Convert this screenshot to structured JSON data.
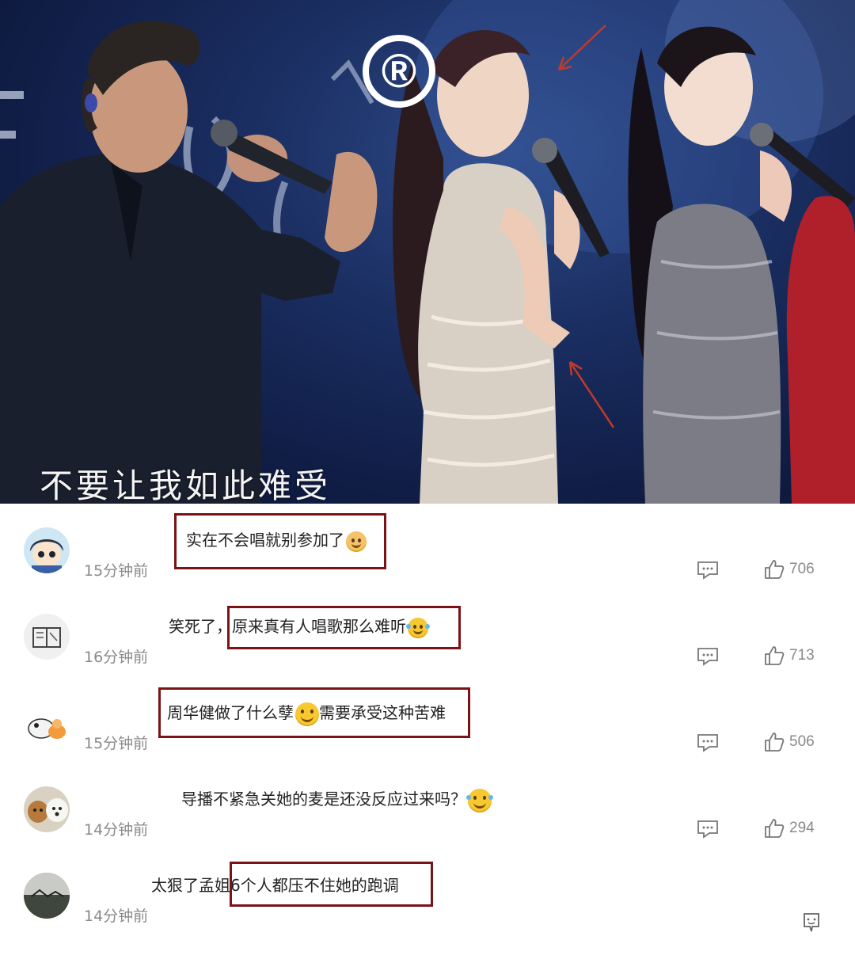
{
  "video": {
    "subtitle": "不要让我如此难受",
    "reg_mark": "®"
  },
  "comments": [
    {
      "prefix": "",
      "highlight": "实在不会唱就别参加了",
      "emoji": "doll-emoji",
      "suffix": "",
      "time": "15分钟前",
      "likes": "706"
    },
    {
      "prefix": "笑死了，",
      "highlight": "原来真有人唱歌那么难听",
      "emoji": "laugh-cry-emoji",
      "suffix": "",
      "time": "16分钟前",
      "likes": "713"
    },
    {
      "prefix": "",
      "highlight": "周华健做了什么孽",
      "emoji": "smile-emoji",
      "highlight_after": "需要承受这种苦难",
      "time": "15分钟前",
      "likes": "506"
    },
    {
      "prefix": "导播不紧急关她的麦是还没反应过来吗？",
      "highlight": "",
      "emoji": "laugh-cry-emoji",
      "suffix": "",
      "time": "14分钟前",
      "likes": "294"
    },
    {
      "prefix": "太狠了孟姐",
      "highlight": "6个人都压不住她的跑调",
      "emoji": "",
      "suffix": "",
      "time": "14分钟前",
      "likes": ""
    }
  ],
  "colors": {
    "highlight_border": "#7a1216",
    "arrow": "#c0392b",
    "muted_text": "#8a8a8a"
  }
}
